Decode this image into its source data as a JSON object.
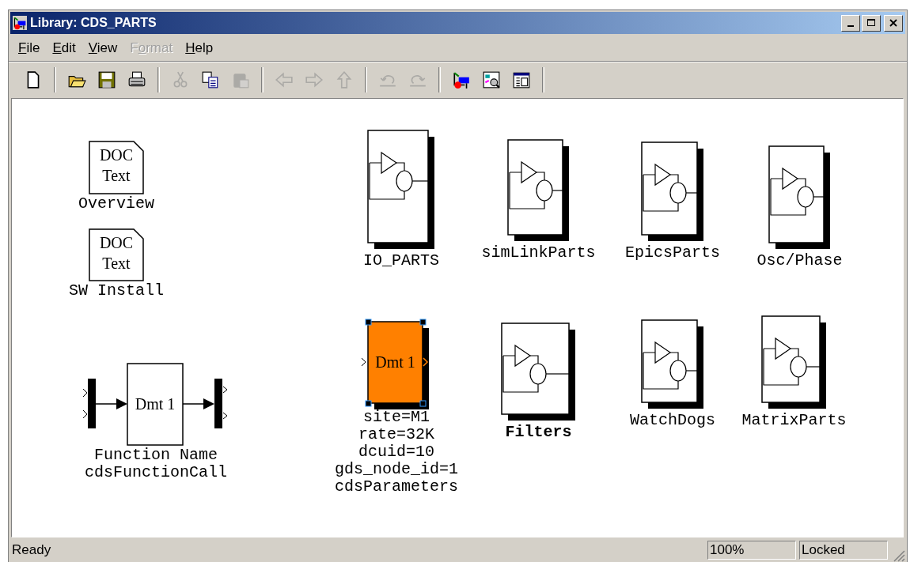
{
  "window": {
    "title": "Library: CDS_PARTS"
  },
  "menu": [
    {
      "label": "File",
      "disabled": false
    },
    {
      "label": "Edit",
      "disabled": false
    },
    {
      "label": "View",
      "disabled": false
    },
    {
      "label": "Format",
      "disabled": true
    },
    {
      "label": "Help",
      "disabled": false
    }
  ],
  "toolbar": [
    {
      "kind": "new",
      "disabled": false
    },
    {
      "kind": "separator"
    },
    {
      "kind": "open",
      "disabled": false
    },
    {
      "kind": "save",
      "disabled": false
    },
    {
      "kind": "print",
      "disabled": false
    },
    {
      "kind": "separator"
    },
    {
      "kind": "cut",
      "disabled": true
    },
    {
      "kind": "copy",
      "disabled": false
    },
    {
      "kind": "paste",
      "disabled": true
    },
    {
      "kind": "separator"
    },
    {
      "kind": "back",
      "disabled": true
    },
    {
      "kind": "forward",
      "disabled": true
    },
    {
      "kind": "up",
      "disabled": true
    },
    {
      "kind": "separator"
    },
    {
      "kind": "undo",
      "disabled": true
    },
    {
      "kind": "redo",
      "disabled": true
    },
    {
      "kind": "separator"
    },
    {
      "kind": "library",
      "disabled": false
    },
    {
      "kind": "explore",
      "disabled": false
    },
    {
      "kind": "properties",
      "disabled": false
    },
    {
      "kind": "separator"
    }
  ],
  "canvas": {
    "items": [
      {
        "kind": "doc",
        "lines": [
          "DOC",
          "Text"
        ],
        "labels": [
          "Overview"
        ],
        "label_bold": false
      },
      {
        "kind": "doc",
        "lines": [
          "DOC",
          "Text"
        ],
        "labels": [
          "SW Install"
        ],
        "label_bold": false
      },
      {
        "kind": "subsystem",
        "labels": [
          "IO_PARTS"
        ],
        "selected": false,
        "label_bold": false
      },
      {
        "kind": "subsystem",
        "labels": [
          "simLinkParts"
        ],
        "selected": false,
        "label_bold": false
      },
      {
        "kind": "subsystem",
        "labels": [
          "EpicsParts"
        ],
        "selected": false,
        "label_bold": false
      },
      {
        "kind": "subsystem",
        "labels": [
          "Osc/Phase"
        ],
        "selected": false,
        "label_bold": false
      },
      {
        "kind": "function_call",
        "block_text": "Dmt 1",
        "labels": [
          "Function Name",
          "cdsFunctionCall"
        ],
        "label_bold": false
      },
      {
        "kind": "parameters",
        "block_text": "Dmt 1",
        "color": "#ff8000",
        "labels": [
          "site=M1",
          "rate=32K",
          "dcuid=10",
          "gds_node_id=1",
          "cdsParameters"
        ],
        "selected": true,
        "label_bold": false
      },
      {
        "kind": "subsystem",
        "labels": [
          "Filters"
        ],
        "selected": false,
        "label_bold": true
      },
      {
        "kind": "subsystem",
        "labels": [
          "WatchDogs"
        ],
        "selected": false,
        "label_bold": false
      },
      {
        "kind": "subsystem",
        "labels": [
          "MatrixParts"
        ],
        "selected": false,
        "label_bold": false
      }
    ]
  },
  "status_bar": {
    "message": "Ready",
    "zoom": "100%",
    "mode": "Locked"
  }
}
